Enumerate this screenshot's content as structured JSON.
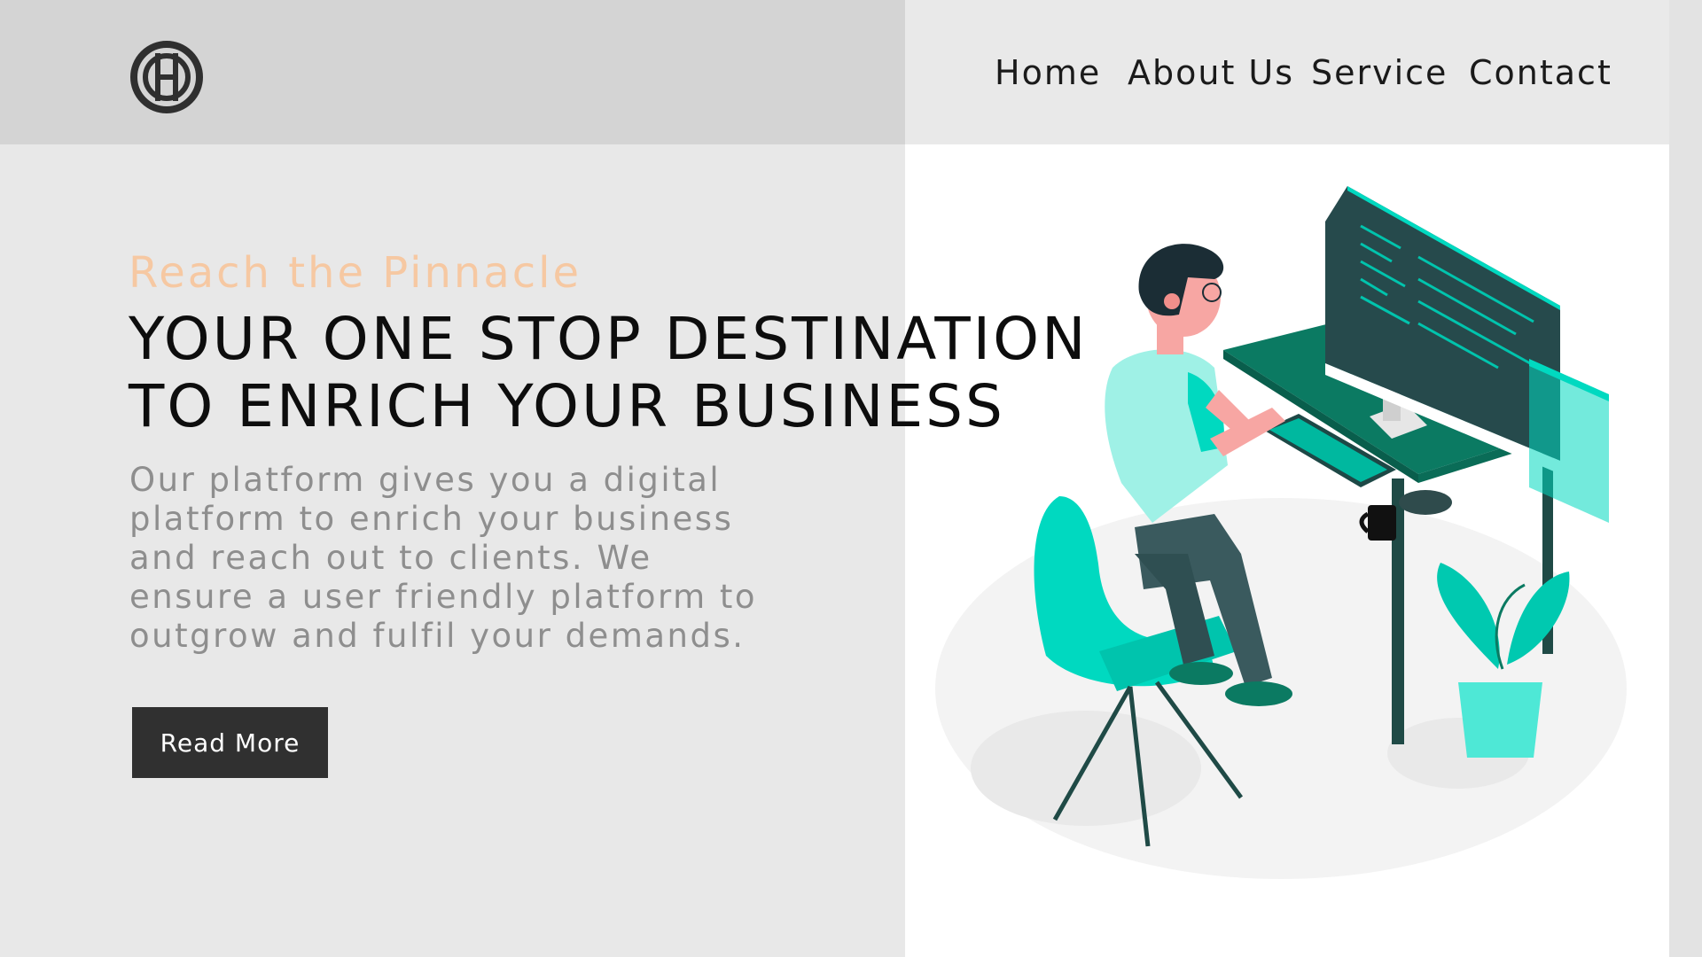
{
  "brand": {
    "logo_icon": "monogram-logo-icon",
    "logo_text": "HA"
  },
  "nav": {
    "items": [
      {
        "label": "Home"
      },
      {
        "label": "About Us"
      },
      {
        "label": "Service"
      },
      {
        "label": "Contact"
      }
    ]
  },
  "hero": {
    "tagline": "Reach the Pinnacle",
    "headline": "YOUR ONE STOP DESTINATION TO ENRICH YOUR BUSINESS",
    "description": "Our platform gives you a digital platform to enrich your business and reach out to clients. We ensure a user friendly platform to outgrow and fulfil your demands.",
    "cta_label": "Read More"
  },
  "illustration": {
    "icon": "developer-at-desk-illustration"
  },
  "colors": {
    "accent_teal": "#00d9c0",
    "dark_teal": "#0b7a62",
    "tagline_peach": "#f6c8a2",
    "button_bg": "#303030"
  }
}
